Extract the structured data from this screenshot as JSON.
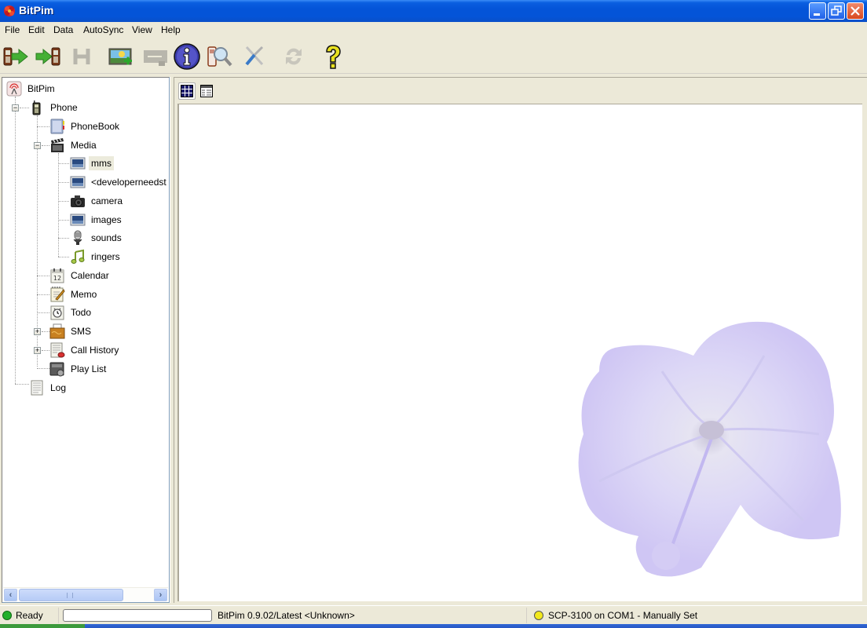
{
  "window": {
    "title": "BitPim",
    "controls": [
      "minimize",
      "restore",
      "close"
    ]
  },
  "menubar": {
    "items": [
      {
        "label": "File"
      },
      {
        "label": "Edit"
      },
      {
        "label": "Data"
      },
      {
        "label": "AutoSync"
      },
      {
        "label": "View"
      },
      {
        "label": "Help"
      }
    ]
  },
  "toolbar": {
    "buttons": [
      {
        "icon": "get-from-phone-icon",
        "enabled": true
      },
      {
        "icon": "send-to-phone-icon",
        "enabled": true
      },
      {
        "icon": "history-icon",
        "enabled": false
      },
      {
        "icon": "add-image-icon",
        "enabled": true
      },
      {
        "icon": "delete-icon",
        "enabled": false
      },
      {
        "icon": "info-icon",
        "enabled": true
      },
      {
        "icon": "detect-phone-icon",
        "enabled": true
      },
      {
        "icon": "settings-tools-icon",
        "enabled": false
      },
      {
        "icon": "refresh-icon",
        "enabled": false
      },
      {
        "icon": "help-icon",
        "enabled": true
      }
    ]
  },
  "tree": {
    "root": "BitPim",
    "phone": "Phone",
    "phonebook": "PhoneBook",
    "media": "Media",
    "media_children": [
      "mms",
      "<developerneedst",
      "camera",
      "images",
      "sounds",
      "ringers"
    ],
    "calendar": "Calendar",
    "memo": "Memo",
    "todo": "Todo",
    "sms": "SMS",
    "call_history": "Call History",
    "play_list": "Play List",
    "log": "Log",
    "selected": "mms"
  },
  "view_toggle": {
    "options": [
      "icon-view",
      "list-view"
    ],
    "active": "icon-view"
  },
  "statusbar": {
    "status": "Ready",
    "status_color": "#22b02a",
    "progress": 0,
    "version": "BitPim 0.9.02/Latest <Unknown>",
    "phone": "SCP-3100 on COM1 - Manually Set",
    "phone_color": "#f2e81c"
  }
}
